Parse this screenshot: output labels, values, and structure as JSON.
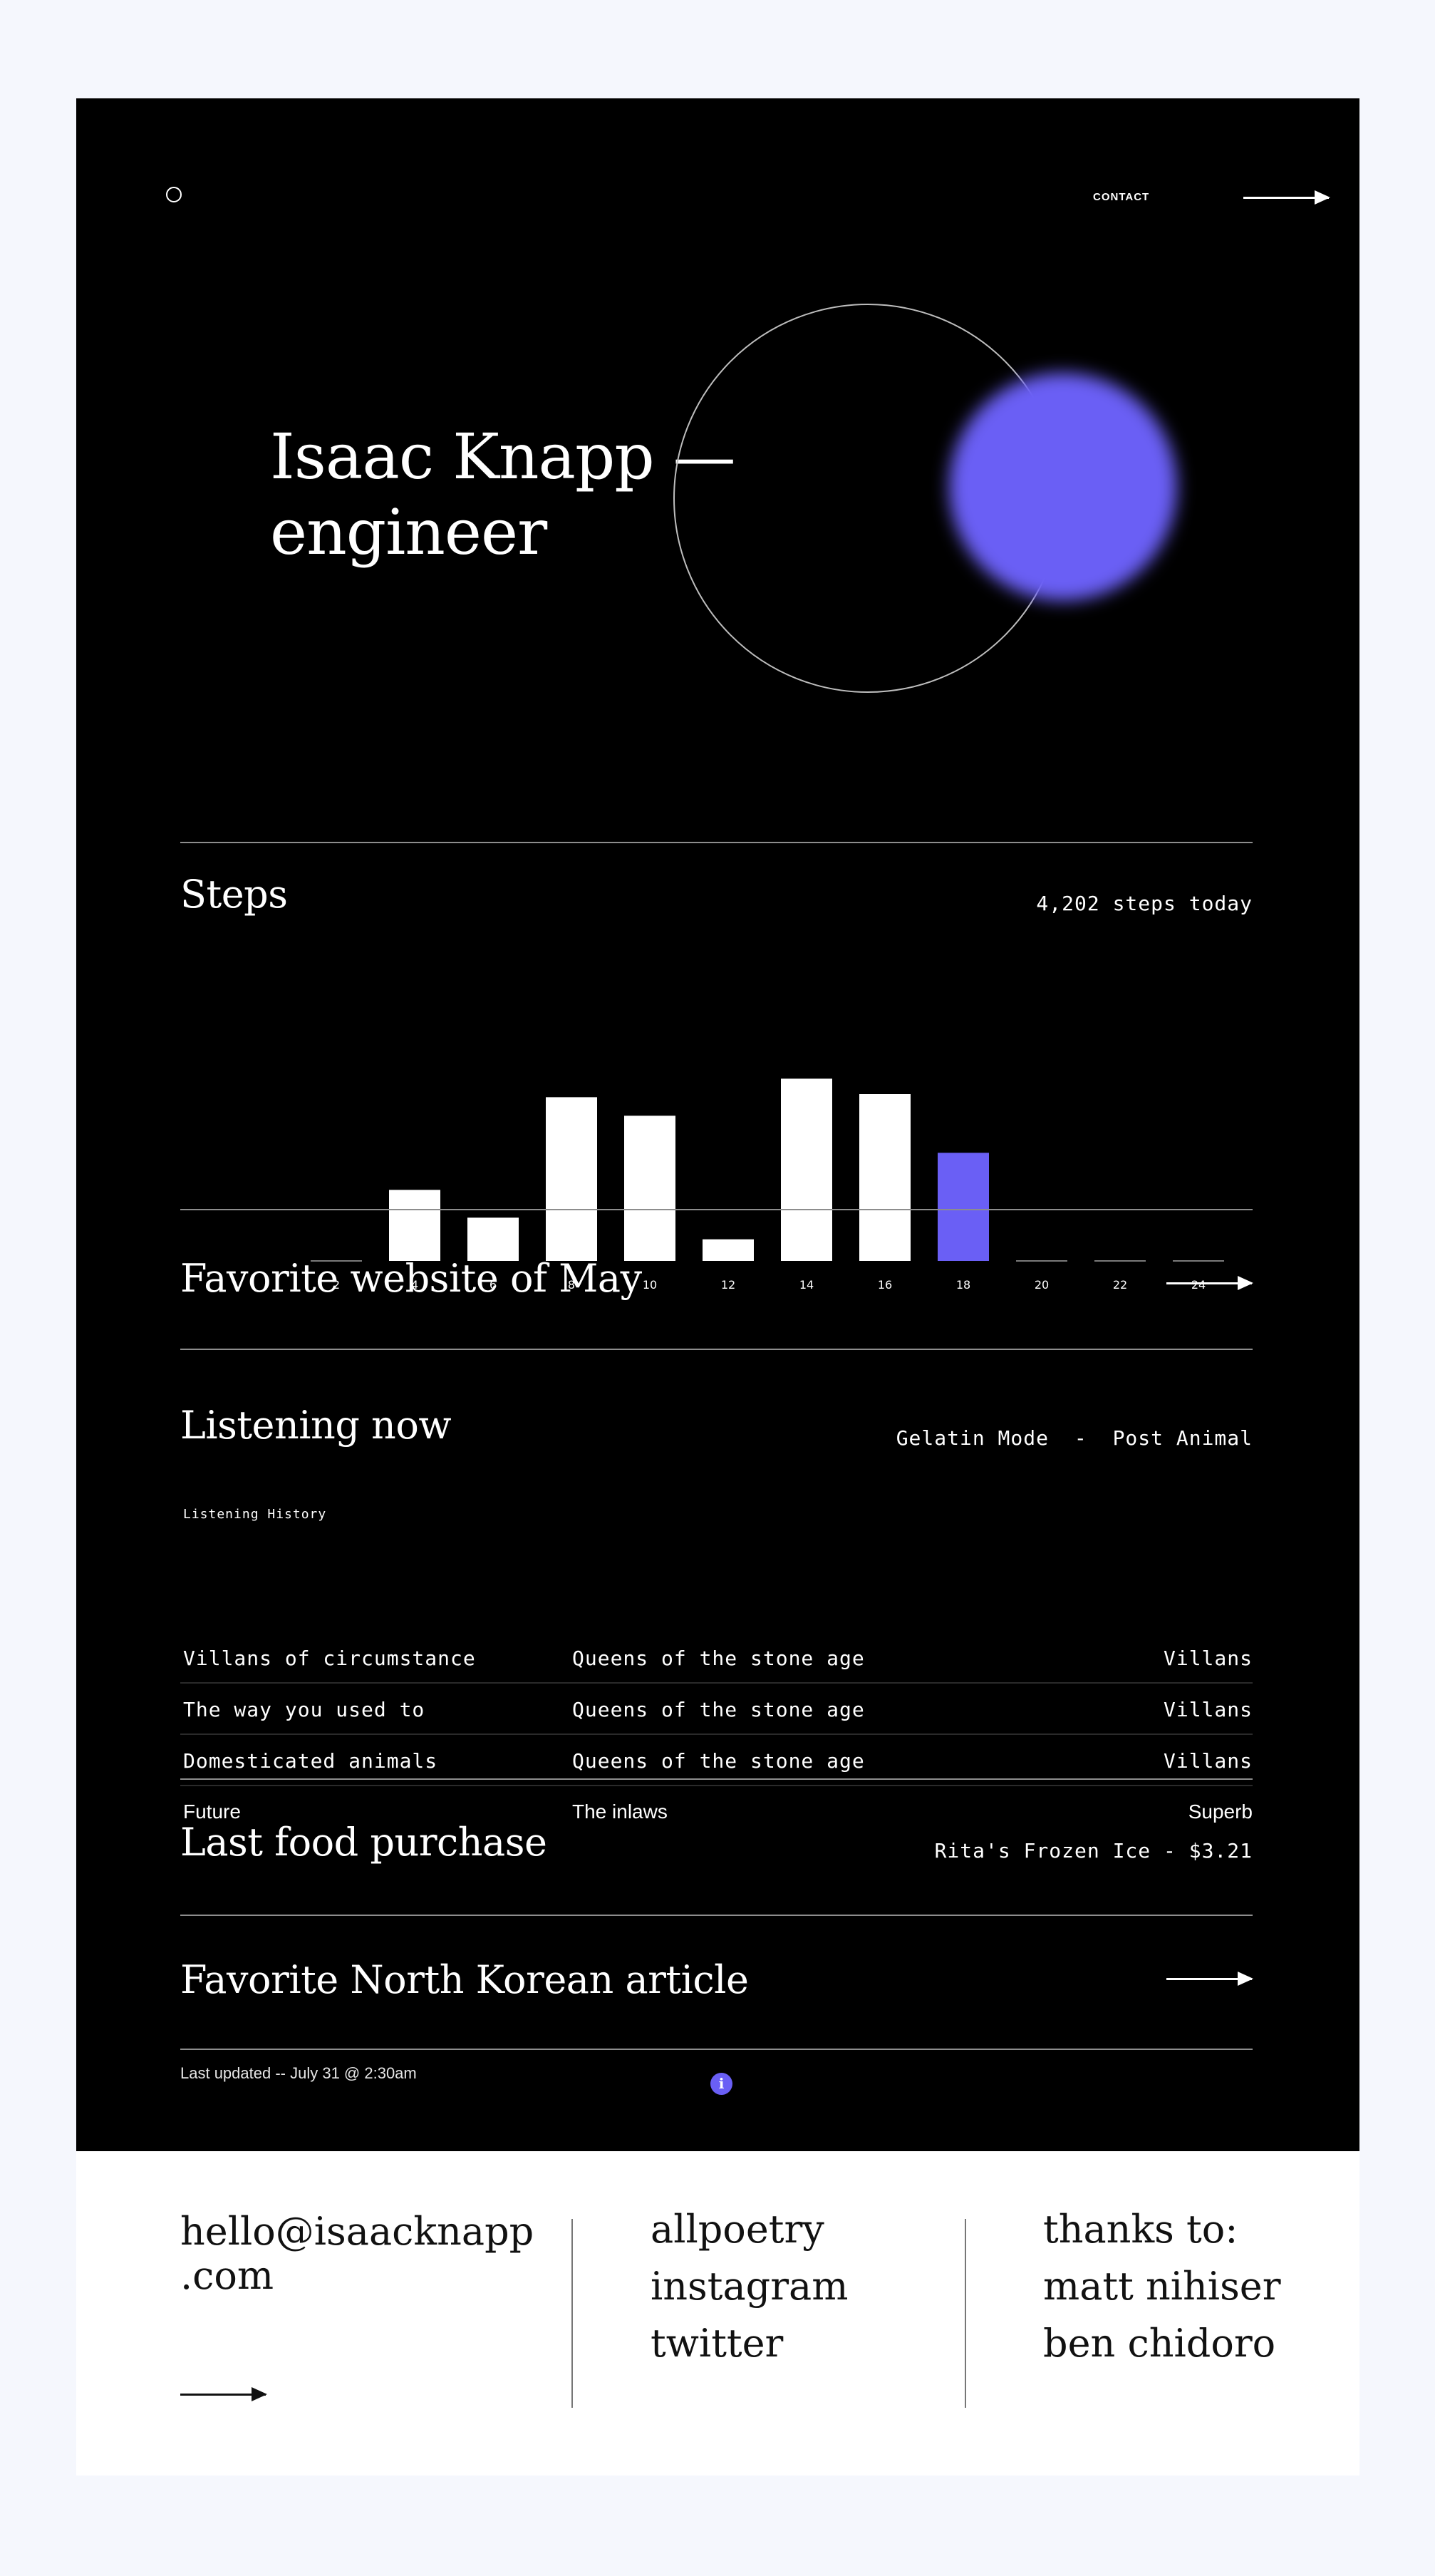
{
  "header": {
    "contact_label": "CONTACT"
  },
  "hero": {
    "line1": "Isaac Knapp —",
    "line2": "engineer"
  },
  "steps": {
    "title": "Steps",
    "summary": "4,202 steps today",
    "accent": "#6a5ff5"
  },
  "chart_data": {
    "type": "bar",
    "categories": [
      "2",
      "4",
      "6",
      "8",
      "10",
      "12",
      "14",
      "16",
      "18",
      "20",
      "22",
      "24"
    ],
    "values": [
      0,
      23,
      14,
      53,
      47,
      7,
      59,
      54,
      35,
      0,
      0,
      0
    ],
    "highlight_index": 8,
    "ylim": [
      0,
      60
    ]
  },
  "favorite_website": {
    "title": "Favorite website of May"
  },
  "listening": {
    "title": "Listening now",
    "song": "Gelatin Mode",
    "separator": "-",
    "artist": "Post Animal",
    "history_label": "Listening History",
    "history": [
      {
        "track": "Villans of circumstance",
        "artist": "Queens of the stone age",
        "album": "Villans"
      },
      {
        "track": "The way you used to",
        "artist": "Queens of the stone age",
        "album": "Villans"
      },
      {
        "track": "Domesticated animals",
        "artist": "Queens of the stone age",
        "album": "Villans"
      },
      {
        "track": "Future",
        "artist": "The inlaws",
        "album": "Superb"
      }
    ]
  },
  "food": {
    "title": "Last food purchase",
    "value": "Rita's Frozen Ice - $3.21"
  },
  "article": {
    "title": "Favorite North Korean article",
    "info_glyph": "i"
  },
  "updated": "Last updated -- July 31 @ 2:30am",
  "footer": {
    "email_line1": "hello@isaacknapp",
    "email_line2": ".com",
    "links": [
      "allpoetry",
      "instagram",
      "twitter"
    ],
    "thanks_label": "thanks to:",
    "thanks": [
      "matt nihiser",
      "ben chidoro"
    ]
  }
}
